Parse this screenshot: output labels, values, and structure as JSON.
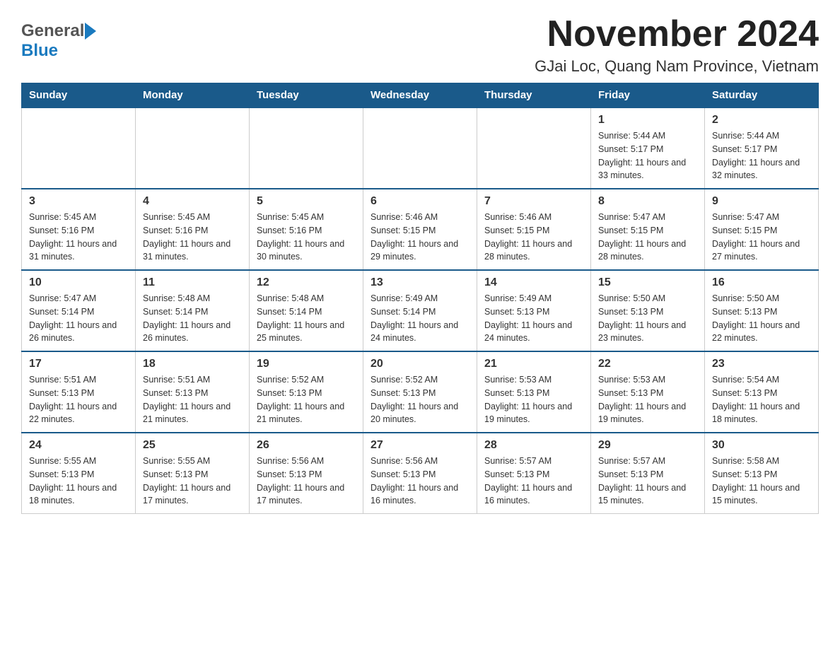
{
  "header": {
    "logo": {
      "general": "General",
      "blue": "Blue",
      "line1": "General",
      "line2": "Blue"
    },
    "title": "November 2024",
    "subtitle": "GJai Loc, Quang Nam Province, Vietnam"
  },
  "calendar": {
    "days_of_week": [
      "Sunday",
      "Monday",
      "Tuesday",
      "Wednesday",
      "Thursday",
      "Friday",
      "Saturday"
    ],
    "weeks": [
      [
        {
          "day": "",
          "info": ""
        },
        {
          "day": "",
          "info": ""
        },
        {
          "day": "",
          "info": ""
        },
        {
          "day": "",
          "info": ""
        },
        {
          "day": "",
          "info": ""
        },
        {
          "day": "1",
          "info": "Sunrise: 5:44 AM\nSunset: 5:17 PM\nDaylight: 11 hours and 33 minutes."
        },
        {
          "day": "2",
          "info": "Sunrise: 5:44 AM\nSunset: 5:17 PM\nDaylight: 11 hours and 32 minutes."
        }
      ],
      [
        {
          "day": "3",
          "info": "Sunrise: 5:45 AM\nSunset: 5:16 PM\nDaylight: 11 hours and 31 minutes."
        },
        {
          "day": "4",
          "info": "Sunrise: 5:45 AM\nSunset: 5:16 PM\nDaylight: 11 hours and 31 minutes."
        },
        {
          "day": "5",
          "info": "Sunrise: 5:45 AM\nSunset: 5:16 PM\nDaylight: 11 hours and 30 minutes."
        },
        {
          "day": "6",
          "info": "Sunrise: 5:46 AM\nSunset: 5:15 PM\nDaylight: 11 hours and 29 minutes."
        },
        {
          "day": "7",
          "info": "Sunrise: 5:46 AM\nSunset: 5:15 PM\nDaylight: 11 hours and 28 minutes."
        },
        {
          "day": "8",
          "info": "Sunrise: 5:47 AM\nSunset: 5:15 PM\nDaylight: 11 hours and 28 minutes."
        },
        {
          "day": "9",
          "info": "Sunrise: 5:47 AM\nSunset: 5:15 PM\nDaylight: 11 hours and 27 minutes."
        }
      ],
      [
        {
          "day": "10",
          "info": "Sunrise: 5:47 AM\nSunset: 5:14 PM\nDaylight: 11 hours and 26 minutes."
        },
        {
          "day": "11",
          "info": "Sunrise: 5:48 AM\nSunset: 5:14 PM\nDaylight: 11 hours and 26 minutes."
        },
        {
          "day": "12",
          "info": "Sunrise: 5:48 AM\nSunset: 5:14 PM\nDaylight: 11 hours and 25 minutes."
        },
        {
          "day": "13",
          "info": "Sunrise: 5:49 AM\nSunset: 5:14 PM\nDaylight: 11 hours and 24 minutes."
        },
        {
          "day": "14",
          "info": "Sunrise: 5:49 AM\nSunset: 5:13 PM\nDaylight: 11 hours and 24 minutes."
        },
        {
          "day": "15",
          "info": "Sunrise: 5:50 AM\nSunset: 5:13 PM\nDaylight: 11 hours and 23 minutes."
        },
        {
          "day": "16",
          "info": "Sunrise: 5:50 AM\nSunset: 5:13 PM\nDaylight: 11 hours and 22 minutes."
        }
      ],
      [
        {
          "day": "17",
          "info": "Sunrise: 5:51 AM\nSunset: 5:13 PM\nDaylight: 11 hours and 22 minutes."
        },
        {
          "day": "18",
          "info": "Sunrise: 5:51 AM\nSunset: 5:13 PM\nDaylight: 11 hours and 21 minutes."
        },
        {
          "day": "19",
          "info": "Sunrise: 5:52 AM\nSunset: 5:13 PM\nDaylight: 11 hours and 21 minutes."
        },
        {
          "day": "20",
          "info": "Sunrise: 5:52 AM\nSunset: 5:13 PM\nDaylight: 11 hours and 20 minutes."
        },
        {
          "day": "21",
          "info": "Sunrise: 5:53 AM\nSunset: 5:13 PM\nDaylight: 11 hours and 19 minutes."
        },
        {
          "day": "22",
          "info": "Sunrise: 5:53 AM\nSunset: 5:13 PM\nDaylight: 11 hours and 19 minutes."
        },
        {
          "day": "23",
          "info": "Sunrise: 5:54 AM\nSunset: 5:13 PM\nDaylight: 11 hours and 18 minutes."
        }
      ],
      [
        {
          "day": "24",
          "info": "Sunrise: 5:55 AM\nSunset: 5:13 PM\nDaylight: 11 hours and 18 minutes."
        },
        {
          "day": "25",
          "info": "Sunrise: 5:55 AM\nSunset: 5:13 PM\nDaylight: 11 hours and 17 minutes."
        },
        {
          "day": "26",
          "info": "Sunrise: 5:56 AM\nSunset: 5:13 PM\nDaylight: 11 hours and 17 minutes."
        },
        {
          "day": "27",
          "info": "Sunrise: 5:56 AM\nSunset: 5:13 PM\nDaylight: 11 hours and 16 minutes."
        },
        {
          "day": "28",
          "info": "Sunrise: 5:57 AM\nSunset: 5:13 PM\nDaylight: 11 hours and 16 minutes."
        },
        {
          "day": "29",
          "info": "Sunrise: 5:57 AM\nSunset: 5:13 PM\nDaylight: 11 hours and 15 minutes."
        },
        {
          "day": "30",
          "info": "Sunrise: 5:58 AM\nSunset: 5:13 PM\nDaylight: 11 hours and 15 minutes."
        }
      ]
    ]
  }
}
